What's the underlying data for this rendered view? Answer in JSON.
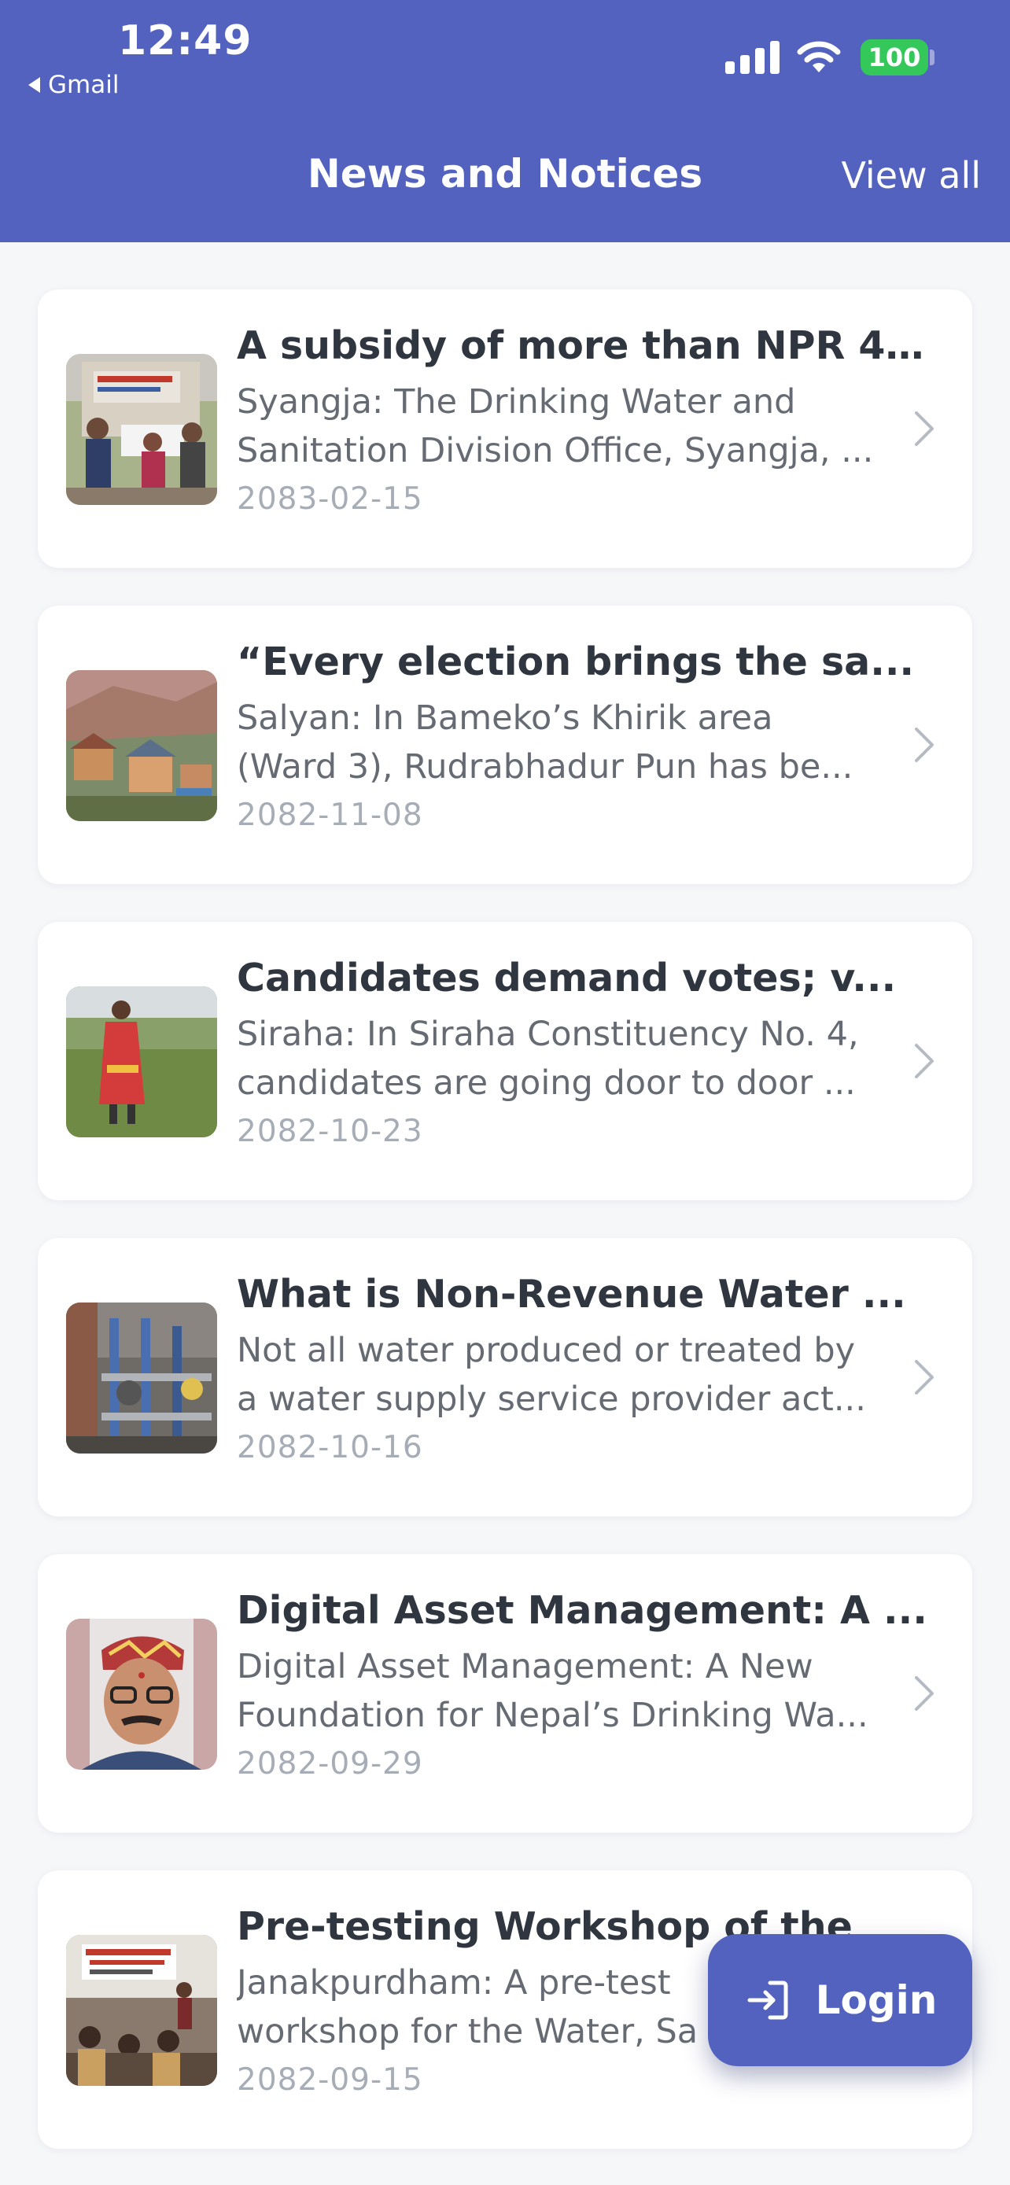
{
  "status_bar": {
    "time": "12:49",
    "back_app": "Gmail",
    "battery": "100",
    "icons": [
      "cellular-signal-icon",
      "wifi-icon",
      "battery-icon"
    ]
  },
  "header": {
    "title": "News and Notices",
    "view_all": "View all",
    "background_color": "#5262be"
  },
  "news": [
    {
      "title": "A subsidy of more than NPR 4...",
      "desc_line1": "Syangja: The Drinking Water and",
      "desc_line2": "Sanitation Division Office, Syangja, ...",
      "date": "2083-02-15"
    },
    {
      "title": "“Every election brings the sa...",
      "desc_line1": "Salyan: In Bameko’s Khirik area",
      "desc_line2": "(Ward 3), Rudrabhadur Pun has be...",
      "date": "2082-11-08"
    },
    {
      "title": "Candidates demand votes; v...",
      "desc_line1": "Siraha: In Siraha Constituency No. 4,",
      "desc_line2": "candidates are going door to door ...",
      "date": "2082-10-23"
    },
    {
      "title": "What is Non-Revenue Water ...",
      "desc_line1": "Not all water produced or treated by",
      "desc_line2": "a water supply service provider act...",
      "date": "2082-10-16"
    },
    {
      "title": "Digital Asset Management: A ...",
      "desc_line1": "Digital Asset Management: A New",
      "desc_line2": "Foundation for Nepal’s Drinking Wa...",
      "date": "2082-09-29"
    },
    {
      "title": "Pre-testing Workshop of the",
      "desc_line1": "Janakpurdham: A pre-test",
      "desc_line2": "workshop for the Water, Sa",
      "date": "2082-09-15"
    }
  ],
  "login_button": {
    "label": "Login",
    "icon": "login-icon"
  }
}
